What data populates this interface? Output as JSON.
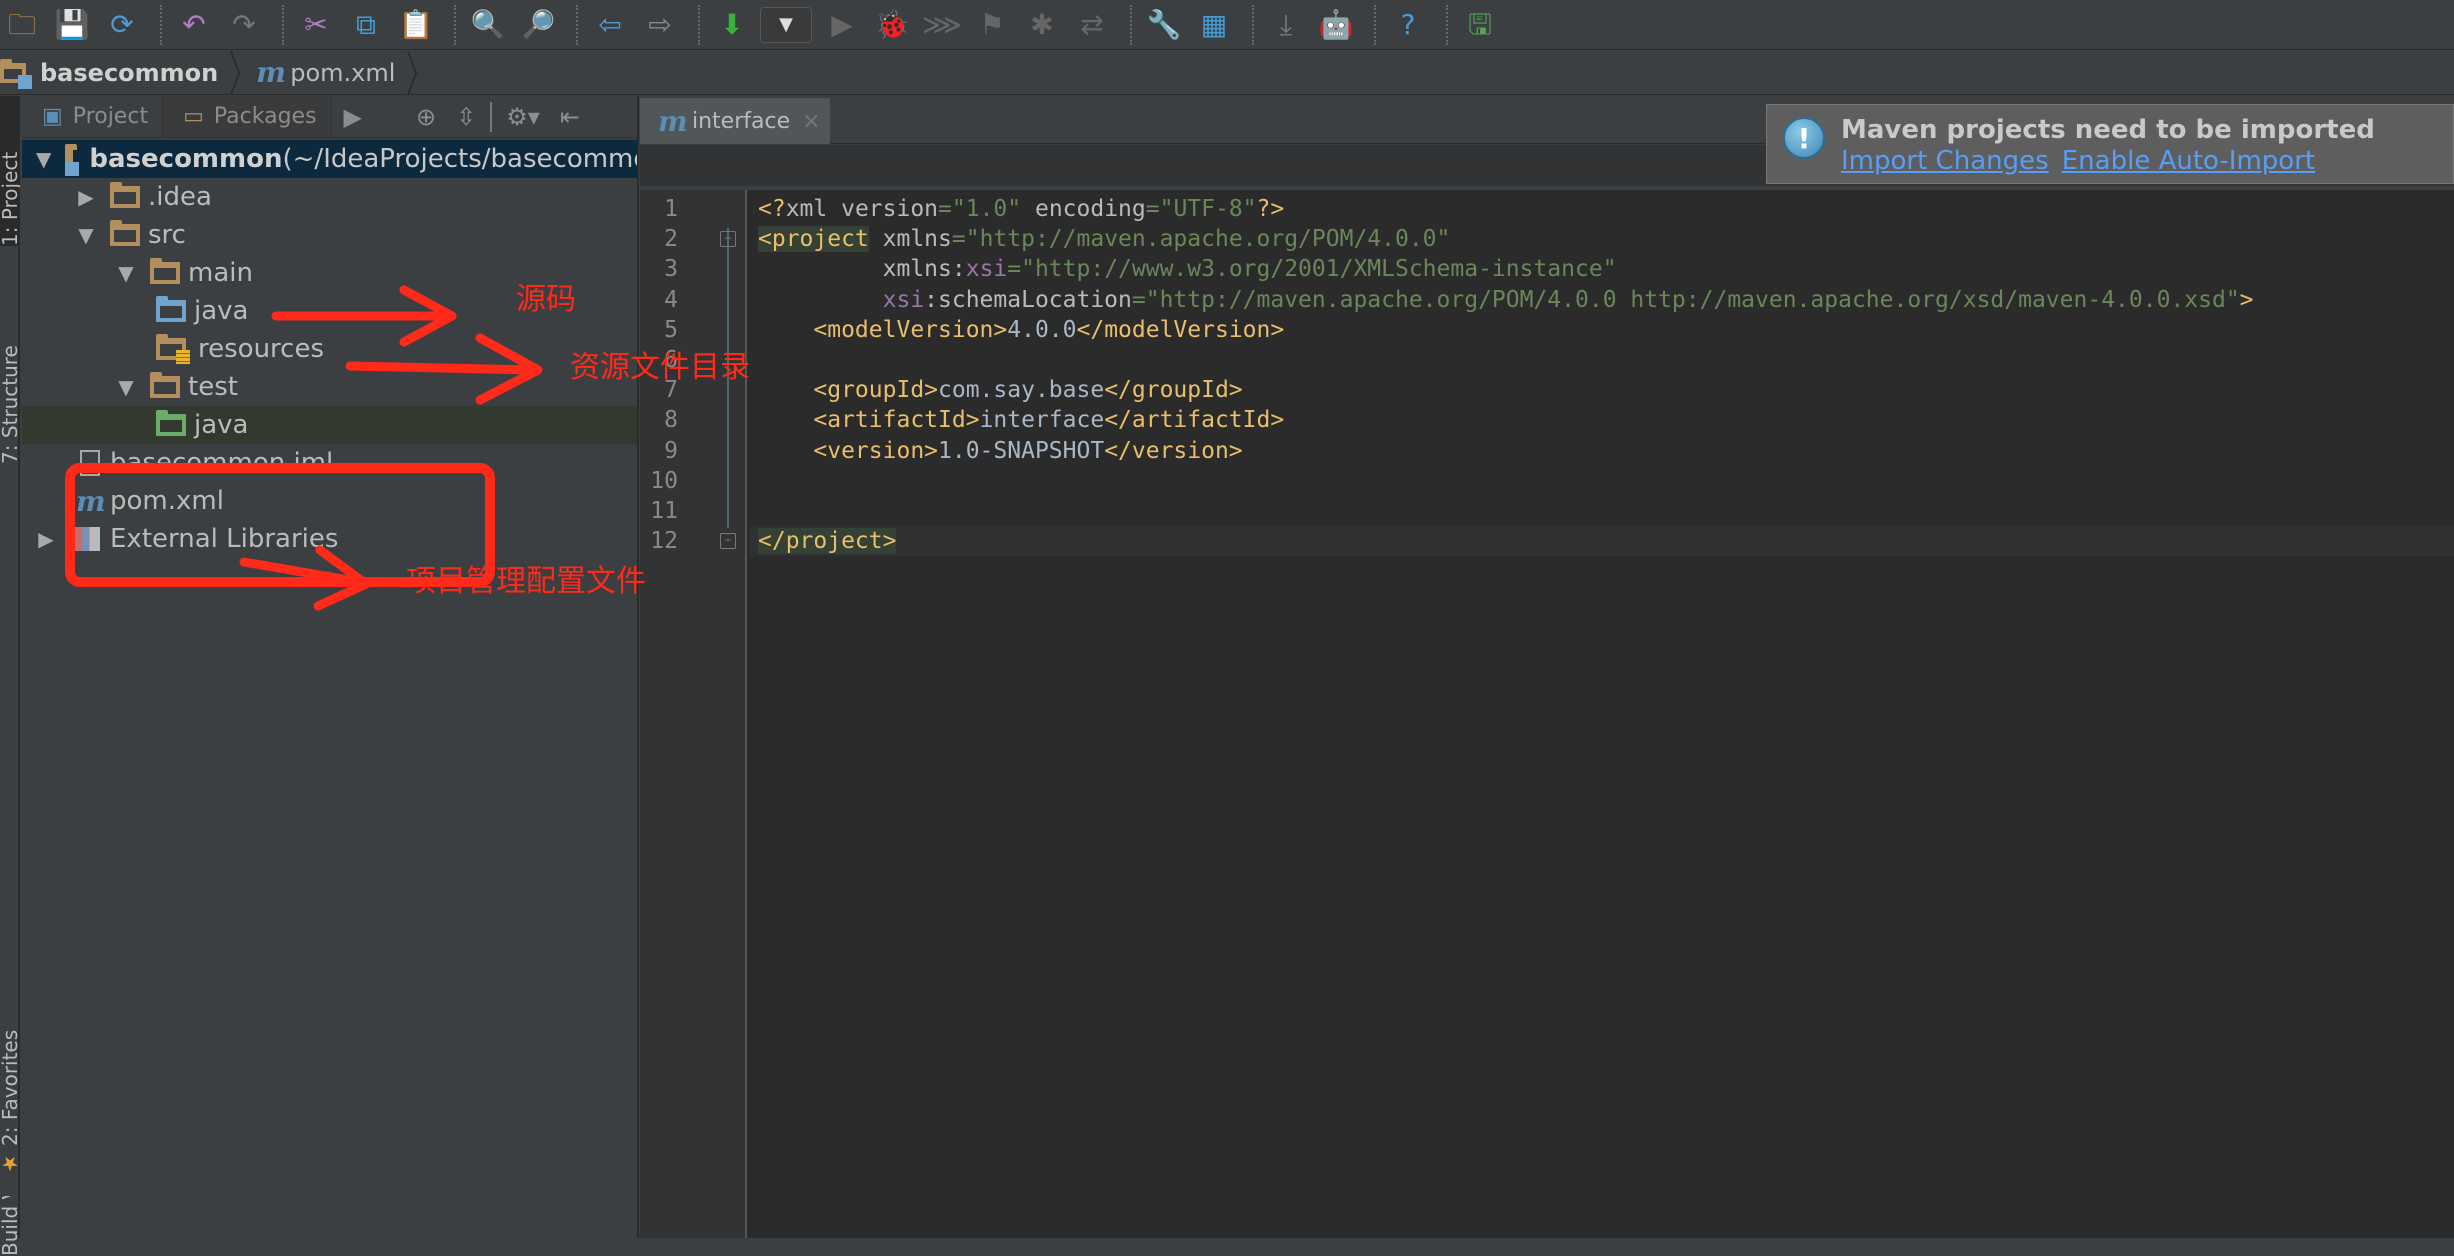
{
  "toolbar": {
    "buttons": [
      {
        "name": "open-folder-icon",
        "glyph": "🗀",
        "color": "#c8924a"
      },
      {
        "name": "save-icon",
        "glyph": "💾",
        "color": "#a8a8a8"
      },
      {
        "name": "sync-icon",
        "glyph": "⟳",
        "color": "#4a9ad4"
      },
      {
        "sep": true
      },
      {
        "name": "undo-icon",
        "glyph": "↶",
        "color": "#b07cc6"
      },
      {
        "name": "redo-icon",
        "glyph": "↷",
        "color": "#777777"
      },
      {
        "sep": true
      },
      {
        "name": "cut-icon",
        "glyph": "✂",
        "color": "#b07cc6"
      },
      {
        "name": "copy-icon",
        "glyph": "⧉",
        "color": "#4a9ad4"
      },
      {
        "name": "paste-icon",
        "glyph": "📋",
        "color": "#c8924a"
      },
      {
        "sep": true
      },
      {
        "name": "find-icon",
        "glyph": "🔍",
        "color": "#a8a8a8"
      },
      {
        "name": "replace-icon",
        "glyph": "🔎",
        "color": "#a8a8a8"
      },
      {
        "sep": true
      },
      {
        "name": "back-icon",
        "glyph": "⇦",
        "color": "#4a9ad4"
      },
      {
        "name": "forward-icon",
        "glyph": "⇨",
        "color": "#888888"
      },
      {
        "sep": true
      },
      {
        "name": "make-project-icon",
        "glyph": "⬇",
        "color": "#3cae3c"
      },
      {
        "combo": true
      },
      {
        "name": "run-icon",
        "glyph": "▶",
        "color": "#666666"
      },
      {
        "name": "debug-icon",
        "glyph": "🐞",
        "color": "#666666"
      },
      {
        "name": "coverage-icon",
        "glyph": "⋙",
        "color": "#666666"
      },
      {
        "name": "profile-icon",
        "glyph": "⚑",
        "color": "#666666"
      },
      {
        "name": "debug-jr-icon",
        "glyph": "✱",
        "color": "#666666"
      },
      {
        "name": "reload-icon",
        "glyph": "⇄",
        "color": "#666666"
      },
      {
        "sep": true
      },
      {
        "name": "settings-wrench-icon",
        "glyph": "🔧",
        "color": "#c8924a"
      },
      {
        "name": "project-structure-icon",
        "glyph": "▦",
        "color": "#4a9ad4"
      },
      {
        "sep": true
      },
      {
        "name": "sdk-manager-icon",
        "glyph": "⤓",
        "color": "#777777"
      },
      {
        "name": "android-icon",
        "glyph": "🤖",
        "color": "#777777"
      },
      {
        "sep": true
      },
      {
        "name": "help-icon",
        "glyph": "?",
        "color": "#4a9ad4"
      },
      {
        "sep": true
      },
      {
        "name": "plugin-save-icon",
        "glyph": "🖫",
        "color": "#56a556"
      }
    ]
  },
  "breadcrumb": {
    "items": [
      {
        "label": "basecommon",
        "icon": "module-folder-icon"
      },
      {
        "label": "pom.xml",
        "icon": "maven-file-icon"
      }
    ]
  },
  "left_stripe": {
    "tabs": [
      "1: Project",
      "7: Structure",
      "2: Favorites",
      "Build Variants"
    ]
  },
  "project_panel": {
    "view_tabs": [
      {
        "label": "Project",
        "active": true
      },
      {
        "label": "Packages",
        "active": false
      }
    ],
    "tree": [
      {
        "label": "basecommon",
        "suffix": " (~/IdeaProjects/basecommon)",
        "indent": 0,
        "arrow": "▼",
        "icon": "module",
        "selected": true
      },
      {
        "label": ".idea",
        "indent": 1,
        "arrow": "▶",
        "icon": "folder"
      },
      {
        "label": "src",
        "indent": 1,
        "arrow": "▼",
        "icon": "folder"
      },
      {
        "label": "main",
        "indent": 2,
        "arrow": "▼",
        "icon": "folder"
      },
      {
        "label": "java",
        "indent": 3,
        "arrow": "",
        "icon": "source-folder"
      },
      {
        "label": "resources",
        "indent": 3,
        "arrow": "",
        "icon": "resources-folder"
      },
      {
        "label": "test",
        "indent": 2,
        "arrow": "▼",
        "icon": "folder"
      },
      {
        "label": "java",
        "indent": 3,
        "arrow": "",
        "icon": "test-folder",
        "highlight": true
      },
      {
        "label": "basecommon.iml",
        "indent": 1,
        "arrow": "",
        "icon": "file"
      },
      {
        "label": "pom.xml",
        "indent": 1,
        "arrow": "",
        "icon": "maven"
      },
      {
        "label": "External Libraries",
        "indent": 0,
        "arrow": "▶",
        "icon": "library"
      }
    ]
  },
  "editor": {
    "tab": {
      "label": "interface",
      "close": "×"
    },
    "line_numbers": [
      "1",
      "2",
      "3",
      "4",
      "5",
      "6",
      "7",
      "8",
      "9",
      "10",
      "11",
      "12"
    ],
    "lines": [
      [
        {
          "c": "t",
          "s": "<?"
        },
        {
          "c": "a",
          "s": "xml version"
        },
        {
          "c": "v",
          "s": "=\"1.0\""
        },
        {
          "c": "a",
          "s": " encoding"
        },
        {
          "c": "v",
          "s": "=\"UTF-8\""
        },
        {
          "c": "t",
          "s": "?>"
        }
      ],
      [
        {
          "c": "t hl",
          "s": "<project"
        },
        {
          "c": "a",
          "s": " xmlns"
        },
        {
          "c": "v",
          "s": "=\"http://maven.apache.org/POM/4.0.0\""
        }
      ],
      [
        {
          "c": "a",
          "s": "         xmlns:"
        },
        {
          "c": "ns",
          "s": "xsi"
        },
        {
          "c": "v",
          "s": "=\"http://www.w3.org/2001/XMLSchema-instance\""
        }
      ],
      [
        {
          "c": "ns",
          "s": "         xsi"
        },
        {
          "c": "a",
          "s": ":schemaLocation"
        },
        {
          "c": "v",
          "s": "=\"http://maven.apache.org/POM/4.0.0 http://maven.apache.org/xsd/maven-4.0.0.xsd\""
        },
        {
          "c": "t",
          "s": ">"
        }
      ],
      [
        {
          "c": "t",
          "s": "    <modelVersion>"
        },
        {
          "c": "tx",
          "s": "4.0.0"
        },
        {
          "c": "t",
          "s": "</modelVersion>"
        }
      ],
      [],
      [
        {
          "c": "t",
          "s": "    <groupId>"
        },
        {
          "c": "tx",
          "s": "com.say.base"
        },
        {
          "c": "t",
          "s": "</groupId>"
        }
      ],
      [
        {
          "c": "t",
          "s": "    <artifactId>"
        },
        {
          "c": "tx",
          "s": "interface"
        },
        {
          "c": "t",
          "s": "</artifactId>"
        }
      ],
      [
        {
          "c": "t",
          "s": "    <version>"
        },
        {
          "c": "tx",
          "s": "1.0-SNAPSHOT"
        },
        {
          "c": "t",
          "s": "</version>"
        }
      ],
      [],
      [],
      [
        {
          "c": "t hl",
          "s": "</project>"
        }
      ]
    ]
  },
  "notification": {
    "title": "Maven projects need to be imported",
    "links": [
      "Import Changes",
      "Enable Auto-Import"
    ]
  },
  "annotations": {
    "source_label": "源码",
    "resources_label": "资源文件目录",
    "pom_label": "项目管理配置文件",
    "color": "#ff2a1a"
  }
}
